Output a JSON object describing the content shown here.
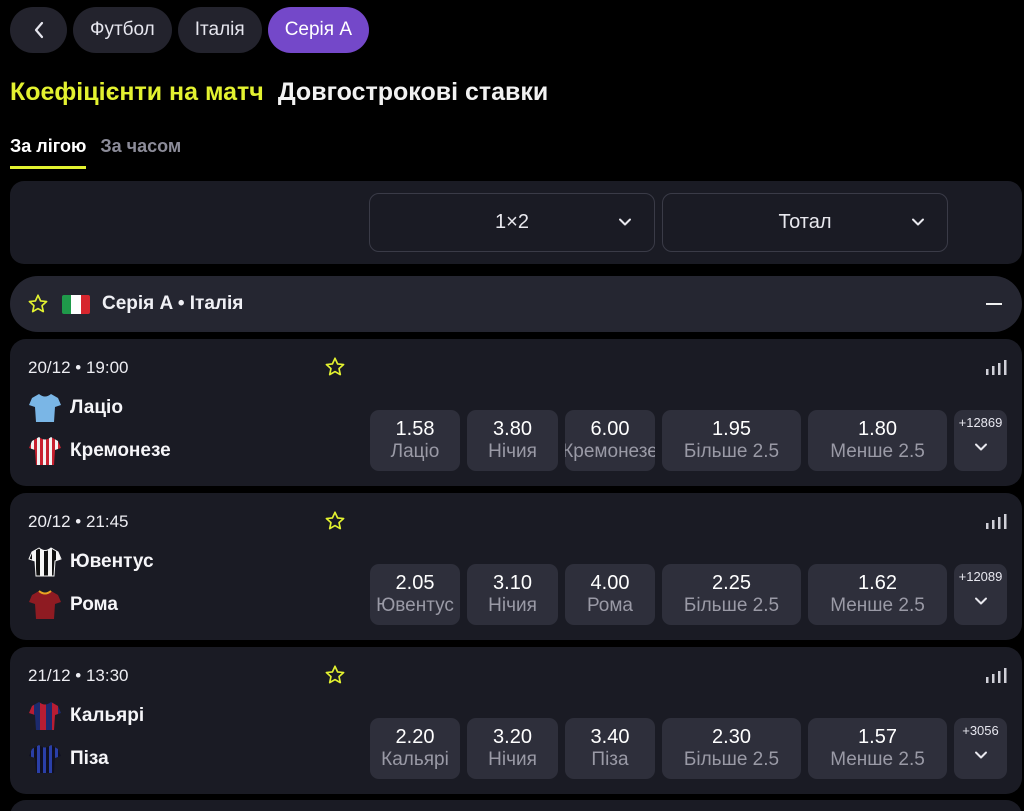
{
  "breadcrumbs": [
    "Футбол",
    "Італія",
    "Серія A"
  ],
  "heading": {
    "active": "Коефіцієнти на матч",
    "other": "Довгострокові ставки"
  },
  "subtabs": {
    "active": "За лігою",
    "inactive": "За часом"
  },
  "filters": {
    "market1": "1×2",
    "market2": "Тотал"
  },
  "league": {
    "name": "Серія A • Італія"
  },
  "colors": {
    "accent": "#e3f230",
    "active_crumb": "#7448c9",
    "card_bg": "#1a1b24",
    "odds_bg": "#2e2f3b"
  },
  "matches": [
    {
      "time": "20/12 • 19:00",
      "home": "Лаціо",
      "away": "Кремонезе",
      "odds": [
        {
          "value": "1.58",
          "label": "Лаціо"
        },
        {
          "value": "3.80",
          "label": "Нічия"
        },
        {
          "value": "6.00",
          "label": "Кремонезе"
        },
        {
          "value": "1.95",
          "label": "Більше 2.5"
        },
        {
          "value": "1.80",
          "label": "Менше 2.5"
        }
      ],
      "more": "+12869"
    },
    {
      "time": "20/12 • 21:45",
      "home": "Ювентус",
      "away": "Рома",
      "odds": [
        {
          "value": "2.05",
          "label": "Ювентус"
        },
        {
          "value": "3.10",
          "label": "Нічия"
        },
        {
          "value": "4.00",
          "label": "Рома"
        },
        {
          "value": "2.25",
          "label": "Більше 2.5"
        },
        {
          "value": "1.62",
          "label": "Менше 2.5"
        }
      ],
      "more": "+12089"
    },
    {
      "time": "21/12 • 13:30",
      "home": "Кальярі",
      "away": "Піза",
      "odds": [
        {
          "value": "2.20",
          "label": "Кальярі"
        },
        {
          "value": "3.20",
          "label": "Нічия"
        },
        {
          "value": "3.40",
          "label": "Піза"
        },
        {
          "value": "2.30",
          "label": "Більше 2.5"
        },
        {
          "value": "1.57",
          "label": "Менше 2.5"
        }
      ],
      "more": "+3056"
    }
  ]
}
